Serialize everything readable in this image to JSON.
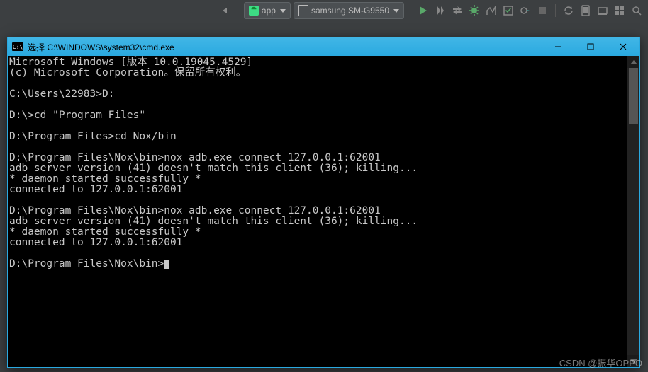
{
  "ide": {
    "run_config": {
      "label": "app"
    },
    "device": {
      "label": "samsung SM-G9550"
    }
  },
  "cmd": {
    "title": "选择 C:\\WINDOWS\\system32\\cmd.exe",
    "lines": [
      "Microsoft Windows [版本 10.0.19045.4529]",
      "(c) Microsoft Corporation。保留所有权利。",
      "",
      "C:\\Users\\22983>D:",
      "",
      "D:\\>cd \"Program Files\"",
      "",
      "D:\\Program Files>cd Nox/bin",
      "",
      "D:\\Program Files\\Nox\\bin>nox_adb.exe connect 127.0.0.1:62001",
      "adb server version (41) doesn't match this client (36); killing...",
      "* daemon started successfully *",
      "connected to 127.0.0.1:62001",
      "",
      "D:\\Program Files\\Nox\\bin>nox_adb.exe connect 127.0.0.1:62001",
      "adb server version (41) doesn't match this client (36); killing...",
      "* daemon started successfully *",
      "connected to 127.0.0.1:62001",
      "",
      "D:\\Program Files\\Nox\\bin>"
    ]
  },
  "watermark": "CSDN @振华OPPO"
}
